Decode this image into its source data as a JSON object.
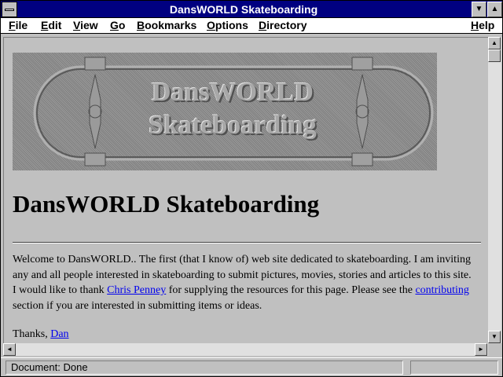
{
  "window": {
    "title": "DansWORLD Skateboarding"
  },
  "menu": {
    "items": [
      {
        "accel": "F",
        "rest": "ile"
      },
      {
        "accel": "E",
        "rest": "dit"
      },
      {
        "accel": "V",
        "rest": "iew"
      },
      {
        "accel": "G",
        "rest": "o"
      },
      {
        "accel": "B",
        "rest": "ookmarks"
      },
      {
        "accel": "O",
        "rest": "ptions"
      },
      {
        "accel": "D",
        "rest": "irectory"
      },
      {
        "accel": "H",
        "rest": "elp"
      }
    ]
  },
  "page": {
    "logo_line1": "DansWORLD",
    "logo_line2": "Skateboarding",
    "heading": "DansWORLD Skateboarding",
    "para_1": "Welcome to DansWORLD.. The first (that I know of) web site dedicated to skateboarding. I am inviting any and all people interested in skateboarding to submit pictures, movies, stories and articles to this site. I would like to thank ",
    "link_chris": "Chris Penney",
    "para_2": " for supplying the resources for this page. Please see the ",
    "link_contributing": "contributing",
    "para_3": " section if you are interested in submitting items or ideas.",
    "thanks_prefix": "Thanks, ",
    "link_dan": "Dan"
  },
  "status": {
    "text": "Document: Done"
  }
}
